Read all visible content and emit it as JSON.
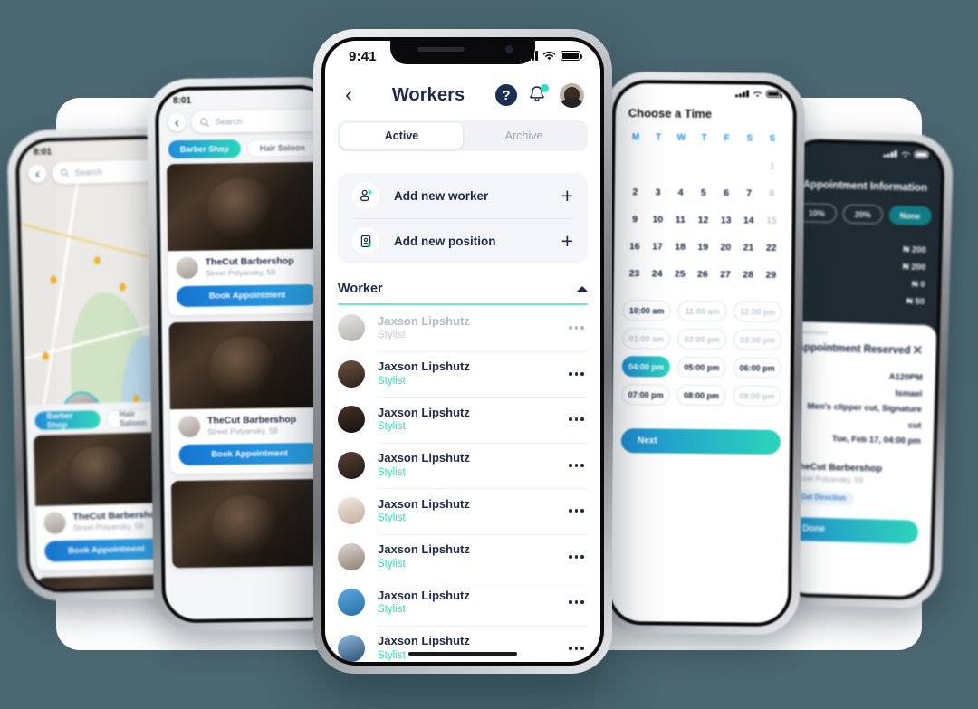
{
  "background_color": "#4a6670",
  "accent_teal": "#2fe0b8",
  "accent_navy": "#1e2a46",
  "main_phone": {
    "status_bar": {
      "time": "9:41",
      "signal_icon": "cellular-bars-icon",
      "wifi_icon": "wifi-icon",
      "battery_icon": "battery-icon"
    },
    "header": {
      "back_icon": "chevron-left-icon",
      "title": "Workers",
      "help_label": "?",
      "help_icon": "help-circle-icon",
      "bell_icon": "notification-bell-icon",
      "avatar_icon": "user-avatar"
    },
    "tabs": [
      {
        "label": "Active",
        "active": true
      },
      {
        "label": "Archive",
        "active": false
      }
    ],
    "add_actions": [
      {
        "label": "Add new worker",
        "icon": "user-plus-icon",
        "plus": "+"
      },
      {
        "label": "Add new position",
        "icon": "badge-plus-icon",
        "plus": "+"
      }
    ],
    "worker_section": {
      "title": "Worker",
      "collapse_icon": "caret-up-icon",
      "rows": [
        {
          "name": "Jaxson Lipshutz",
          "role": "Stylist",
          "muted": true
        },
        {
          "name": "Jaxson Lipshutz",
          "role": "Stylist",
          "muted": false
        },
        {
          "name": "Jaxson Lipshutz",
          "role": "Stylist",
          "muted": false
        },
        {
          "name": "Jaxson Lipshutz",
          "role": "Stylist",
          "muted": false
        },
        {
          "name": "Jaxson Lipshutz",
          "role": "Stylist",
          "muted": false
        },
        {
          "name": "Jaxson Lipshutz",
          "role": "Stylist",
          "muted": false
        },
        {
          "name": "Jaxson Lipshutz",
          "role": "Stylist",
          "muted": false
        },
        {
          "name": "Jaxson Lipshutz",
          "role": "Stylist",
          "muted": false
        }
      ],
      "row_menu_icon": "more-options-icon"
    }
  },
  "phone_far_left": {
    "status_time": "8:01",
    "search_placeholder": "Search",
    "search_icon": "search-icon",
    "back_icon": "chevron-left-icon",
    "chips": [
      {
        "label": "Barber Shop",
        "selected": true
      },
      {
        "label": "Hair Saloon",
        "selected": false
      }
    ],
    "shop": {
      "name": "TheCut Barbershop",
      "address": "Street Polyansky, 59",
      "book_label": "Book Appointment"
    }
  },
  "phone_left": {
    "status_time": "8:01",
    "search_placeholder": "Search",
    "search_icon": "search-icon",
    "back_icon": "chevron-left-icon",
    "chips": [
      {
        "label": "Barber Shop",
        "selected": true
      },
      {
        "label": "Hair Saloon",
        "selected": false
      }
    ],
    "shop": {
      "name": "TheCut Barbershop",
      "address": "Street Polyansky, 59",
      "book_label": "Book Appointment"
    }
  },
  "phone_calendar": {
    "title": "Choose a Time",
    "weekdays": [
      "M",
      "T",
      "W",
      "T",
      "F",
      "S",
      "S"
    ],
    "days": [
      {
        "n": "",
        "dim": false
      },
      {
        "n": "",
        "dim": false
      },
      {
        "n": "",
        "dim": false
      },
      {
        "n": "",
        "dim": false
      },
      {
        "n": "",
        "dim": false
      },
      {
        "n": "",
        "dim": false
      },
      {
        "n": "1",
        "dim": true
      },
      {
        "n": "2",
        "dim": false
      },
      {
        "n": "3",
        "dim": false
      },
      {
        "n": "4",
        "dim": false
      },
      {
        "n": "5",
        "dim": false
      },
      {
        "n": "6",
        "dim": false
      },
      {
        "n": "7",
        "dim": false
      },
      {
        "n": "8",
        "dim": true
      },
      {
        "n": "9",
        "dim": false
      },
      {
        "n": "10",
        "dim": false
      },
      {
        "n": "11",
        "dim": false
      },
      {
        "n": "12",
        "dim": false
      },
      {
        "n": "13",
        "dim": false
      },
      {
        "n": "14",
        "dim": false
      },
      {
        "n": "15",
        "dim": true
      },
      {
        "n": "16",
        "dim": false
      },
      {
        "n": "17",
        "dim": false
      },
      {
        "n": "18",
        "dim": false
      },
      {
        "n": "19",
        "dim": false
      },
      {
        "n": "20",
        "dim": false
      },
      {
        "n": "21",
        "dim": false
      },
      {
        "n": "22",
        "dim": false
      },
      {
        "n": "23",
        "dim": false
      },
      {
        "n": "24",
        "dim": false
      },
      {
        "n": "25",
        "dim": false
      },
      {
        "n": "26",
        "dim": false
      },
      {
        "n": "27",
        "dim": false
      },
      {
        "n": "28",
        "dim": false
      },
      {
        "n": "29",
        "dim": false
      }
    ],
    "slots": [
      {
        "label": "10:00 am",
        "state": "normal"
      },
      {
        "label": "11:00 am",
        "state": "dim"
      },
      {
        "label": "12:00 pm",
        "state": "dim"
      },
      {
        "label": "01:00 am",
        "state": "dim"
      },
      {
        "label": "02:00 pm",
        "state": "dim"
      },
      {
        "label": "03:00 pm",
        "state": "dim"
      },
      {
        "label": "04:00 pm",
        "state": "selected"
      },
      {
        "label": "05:00 pm",
        "state": "normal"
      },
      {
        "label": "06:00 pm",
        "state": "normal"
      },
      {
        "label": "07:00 pm",
        "state": "normal"
      },
      {
        "label": "08:00 pm",
        "state": "normal"
      },
      {
        "label": "09:00 pm",
        "state": "dim"
      }
    ],
    "next_label": "Next"
  },
  "phone_reserved": {
    "page_title": "Appointment Information",
    "tip_options": [
      {
        "label": "10%",
        "selected": false
      },
      {
        "label": "20%",
        "selected": false
      },
      {
        "label": "None",
        "selected": true
      }
    ],
    "prices": [
      "₦ 200",
      "₦ 200",
      "₦ 0",
      "₦ 50"
    ],
    "sheet": {
      "title": "Appointment Reserved",
      "close_icon": "close-icon",
      "code": "A120PM",
      "worker": "Ismael",
      "services": "Men's clipper cut, Signature cut",
      "datetime": "Tue, Feb 17, 04:00 pm",
      "shop_name": "TheCut Barbershop",
      "shop_address": "Street Polyansky, 59",
      "directions_label": "Get Direction",
      "done_label": "Done"
    }
  }
}
